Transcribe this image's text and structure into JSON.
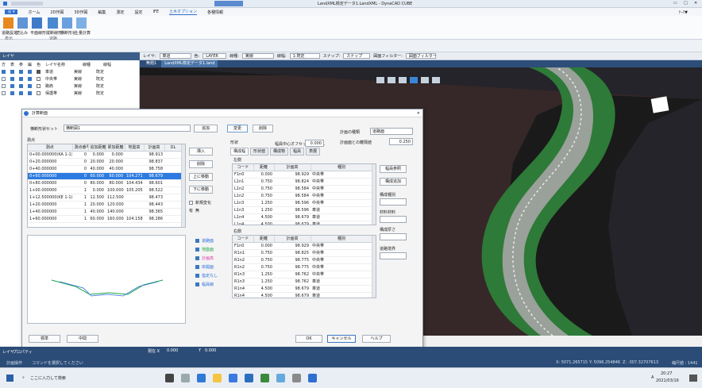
{
  "window": {
    "title": "LandXML検定データ1.LandXML - DynaCAD CUBE",
    "controls": [
      "▭",
      "□",
      "✕"
    ]
  },
  "ribbon": {
    "tabs": [
      "ホーム",
      "2D作図",
      "3D作図",
      "編集",
      "測定",
      "設定",
      "IFE",
      "土木オプション",
      "各種情報"
    ],
    "right": "ﾃｰﾏ▼",
    "groups": [
      "表示",
      "道路"
    ],
    "buttons": [
      "道路設定",
      "読込み",
      "平面線形",
      "縦断線形",
      "横断形状",
      "土量計算"
    ]
  },
  "layer_panel": {
    "title": "レイヤ",
    "headers": [
      "方",
      "表",
      "参",
      "編",
      "色",
      "レイヤ名称",
      "線種",
      "線幅"
    ],
    "rows": [
      {
        "name": "車道",
        "linetype": "実線",
        "width": "既定"
      },
      {
        "name": "中央帯",
        "linetype": "実線",
        "width": "既定"
      },
      {
        "name": "路肩",
        "linetype": "実線",
        "width": "既定"
      },
      {
        "name": "保護帯",
        "linetype": "実線",
        "width": "既定"
      }
    ],
    "bottom_tabs": [
      "レイヤ",
      "プロパティ"
    ]
  },
  "toolbar2": {
    "layer_label": "レイヤ:",
    "layer_value": "車道",
    "color_label": "色:",
    "color_value": "LAYER",
    "linetype_label": "線種:",
    "linetype_value": "実線",
    "width_label": "線幅:",
    "width_value": "1:既定",
    "snap_label": "スナップ:",
    "snap_value": "スナップ",
    "filter_label": "図面フィルター:",
    "filter_value": "図面フィルター"
  },
  "doc_tabs": [
    "無題1",
    "LandXML検定データ1.land"
  ],
  "dialog": {
    "title": "計算断面",
    "set_label": "横断形状セット",
    "set_value": "横断図1",
    "add_button": "追加",
    "change_button": "変更",
    "delete_button": "削除",
    "section_type_label": "計画の種類",
    "section_type_value": "道路面",
    "plane_label": "計画面との離隔値",
    "plane_value": "0.250",
    "station_section": "測点",
    "station_headers": [
      "測点",
      "測点番号",
      "追加距離",
      "累加距離",
      "地盤高",
      "計画高",
      "DL"
    ],
    "stations": [
      {
        "name": "0+00.000000(KA 1-1)",
        "no": "0",
        "add": "0.000",
        "cum": "0.000",
        "gh": "",
        "ph": "98.913",
        "dl": ""
      },
      {
        "name": "0+20.000000",
        "no": "0",
        "add": "20.000",
        "cum": "20.000",
        "gh": "",
        "ph": "98.837",
        "dl": ""
      },
      {
        "name": "0+40.000000",
        "no": "0",
        "add": "40.000",
        "cum": "40.000",
        "gh": "",
        "ph": "98.758",
        "dl": ""
      },
      {
        "name": "0+60.000000",
        "no": "0",
        "add": "60.000",
        "cum": "60.000",
        "gh": "104.271",
        "ph": "98.679",
        "dl": ""
      },
      {
        "name": "0+80.000000",
        "no": "0",
        "add": "80.000",
        "cum": "80.000",
        "gh": "104.434",
        "ph": "98.601",
        "dl": ""
      },
      {
        "name": "1+00.000000",
        "no": "1",
        "add": "0.000",
        "cum": "100.000",
        "gh": "105.205",
        "ph": "98.522",
        "dl": ""
      },
      {
        "name": "1+12.500000(KE 1-1)",
        "no": "1",
        "add": "12.500",
        "cum": "112.500",
        "gh": "",
        "ph": "98.473",
        "dl": ""
      },
      {
        "name": "1+20.000000",
        "no": "1",
        "add": "20.000",
        "cum": "120.000",
        "gh": "",
        "ph": "98.443",
        "dl": ""
      },
      {
        "name": "1+40.000000",
        "no": "1",
        "add": "40.000",
        "cum": "140.000",
        "gh": "",
        "ph": "98.365",
        "dl": ""
      },
      {
        "name": "1+60.000000",
        "no": "1",
        "add": "60.000",
        "cum": "160.000",
        "gh": "104.158",
        "ph": "98.286",
        "dl": ""
      }
    ],
    "insert_button": "挿入",
    "remove_button": "削除",
    "up_button": "上に移動",
    "down_button": "下に移動",
    "new_change_label": "新規変化",
    "radio_on": "有",
    "radio_off": "無",
    "legend": [
      {
        "label": "道路面",
        "color": "#2a6fd8"
      },
      {
        "label": "地盤面",
        "color": "#19a34a"
      },
      {
        "label": "計画高",
        "color": "#d63aa6"
      },
      {
        "label": "床掘面",
        "color": "#2a6fd8"
      },
      {
        "label": "指定なし",
        "color": "#2a6fd8"
      },
      {
        "label": "幅員線",
        "color": "#2a6fd8"
      }
    ],
    "shape_label": "形状",
    "shape_tabs": [
      "構成幅",
      "形状値",
      "構成物",
      "幅員",
      "表層"
    ],
    "centerline_label": "幅員中心オフセット CL離れ",
    "centerline_value": "0.000",
    "left_label": "左側",
    "right_label": "右側",
    "part_headers": [
      "コード",
      "距離",
      "計画高",
      "種別"
    ],
    "left_rows": [
      {
        "code": "F1n0",
        "dist": "0.000",
        "h": "98.929",
        "type": "中央帯"
      },
      {
        "code": "L1n1",
        "dist": "0.750",
        "h": "98.824",
        "type": "中央帯"
      },
      {
        "code": "L1n2",
        "dist": "0.750",
        "h": "98.584",
        "type": "中央帯"
      },
      {
        "code": "L1n2",
        "dist": "0.750",
        "h": "98.584",
        "type": "中央帯"
      },
      {
        "code": "L1n3",
        "dist": "1.250",
        "h": "98.596",
        "type": "中央帯"
      },
      {
        "code": "L1n3",
        "dist": "1.250",
        "h": "98.596",
        "type": "車道"
      },
      {
        "code": "L1n4",
        "dist": "4.500",
        "h": "98.679",
        "type": "車道"
      },
      {
        "code": "L1n4",
        "dist": "4.500",
        "h": "98.679",
        "type": "車道"
      }
    ],
    "right_rows": [
      {
        "code": "F1n0",
        "dist": "0.000",
        "h": "98.929",
        "type": "中央帯"
      },
      {
        "code": "R1n1",
        "dist": "0.750",
        "h": "98.825",
        "type": "中央帯"
      },
      {
        "code": "R1n2",
        "dist": "0.750",
        "h": "98.775",
        "type": "中央帯"
      },
      {
        "code": "R1n2",
        "dist": "0.750",
        "h": "98.775",
        "type": "中央帯"
      },
      {
        "code": "R1n3",
        "dist": "1.250",
        "h": "98.762",
        "type": "中央帯"
      },
      {
        "code": "R1n3",
        "dist": "1.250",
        "h": "98.762",
        "type": "車道"
      },
      {
        "code": "R1n4",
        "dist": "4.500",
        "h": "98.679",
        "type": "車道"
      },
      {
        "code": "R1n4",
        "dist": "4.500",
        "h": "98.679",
        "type": "車道"
      }
    ],
    "side_buttons": [
      "幅員参照",
      "構成追加"
    ],
    "side_labels": [
      "構成種別",
      "材料材料",
      "構成厚さ",
      "道路境界"
    ],
    "footer": {
      "standard": "標準",
      "intermediate": "中間",
      "ok": "OK",
      "cancel": "キャンセル",
      "help": "ヘルプ"
    }
  },
  "status": {
    "coord_label": "現在 X",
    "coord_value": "0.000",
    "y_label": "Y",
    "y_value": "0.000",
    "command_label": "計画操作",
    "command_text": "コマンドを選択してください",
    "x_read": "X: 5071.265715",
    "y_read": "Y: 5096.254846",
    "z_read": "Z: -307.32707613",
    "scale_read": "縮尺値 : 1441"
  },
  "taskbar": {
    "search": "ここに入力して検索",
    "time": "20:27",
    "date": "2021/03/16",
    "ime": "A"
  }
}
